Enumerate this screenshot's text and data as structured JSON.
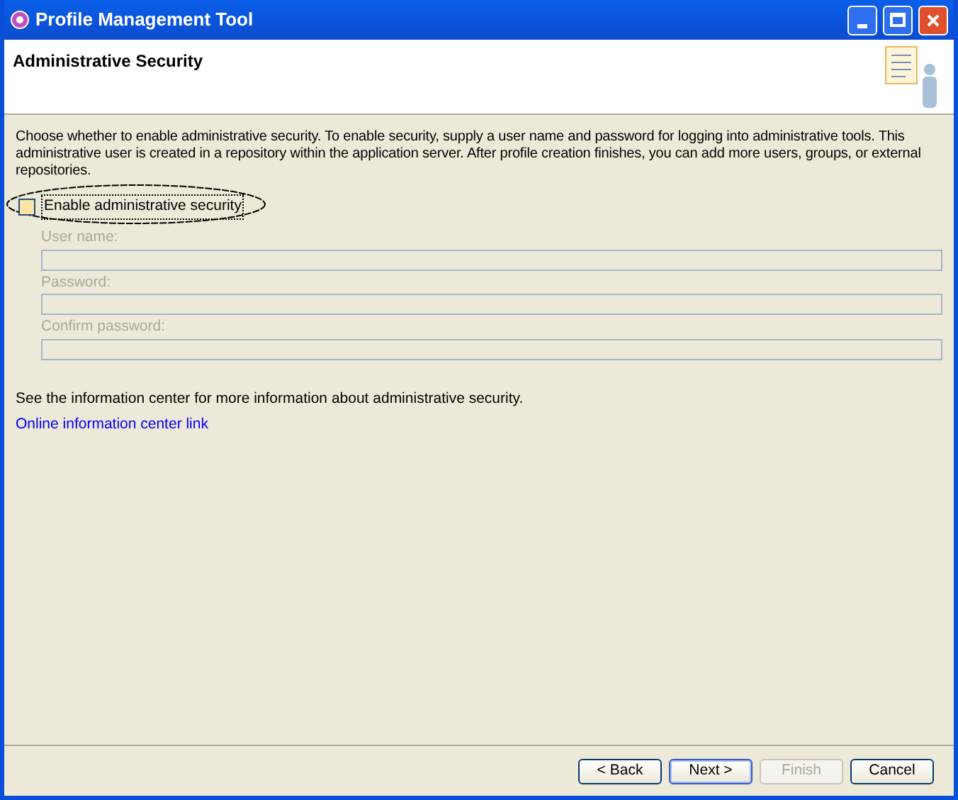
{
  "window": {
    "title": "Profile Management Tool"
  },
  "header": {
    "title": "Administrative Security"
  },
  "description": "Choose whether to enable administrative security. To enable security, supply a user name and password for logging into administrative tools. This administrative user is created in a repository within the application server. After profile creation finishes, you can add more users, groups, or external repositories.",
  "enable_checkbox": {
    "label": "Enable administrative security",
    "checked": false,
    "circled": true
  },
  "fields": [
    {
      "label": "User name:",
      "disabled": true
    },
    {
      "label": "Password:",
      "disabled": true
    },
    {
      "label": "Confirm password:",
      "disabled": true
    }
  ],
  "info_text": "See the information center for more information about administrative security.",
  "link": "Online information center link",
  "buttons": [
    {
      "label": "< Back",
      "disabled": false,
      "default": false
    },
    {
      "label": "Next >",
      "disabled": false,
      "default": true
    },
    {
      "label": "Finish",
      "disabled": true,
      "default": false
    },
    {
      "label": "Cancel",
      "disabled": false,
      "default": false
    }
  ]
}
